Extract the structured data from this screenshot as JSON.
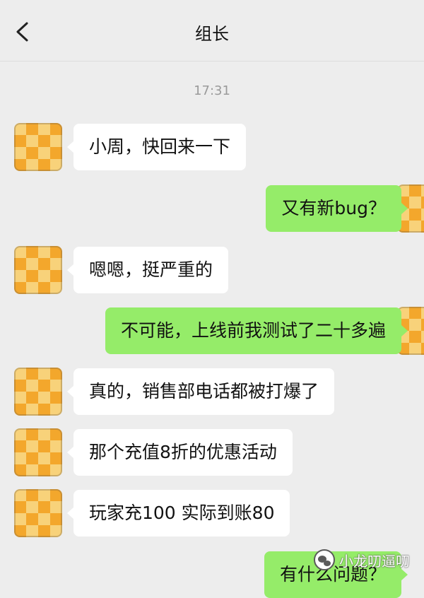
{
  "header": {
    "title": "组长"
  },
  "timestamp": "17:31",
  "messages": [
    {
      "text": "小周，快回来一下",
      "sender": "contact"
    },
    {
      "text": "又有新bug？",
      "sender": "me"
    },
    {
      "text": "嗯嗯，挺严重的",
      "sender": "contact"
    },
    {
      "text": "不可能，上线前我测试了二十多遍",
      "sender": "me"
    },
    {
      "text": "真的，销售部电话都被打爆了",
      "sender": "contact"
    },
    {
      "text": "那个充值8折的优惠活动",
      "sender": "contact"
    },
    {
      "text": "玩家充100 实际到账80",
      "sender": "contact"
    },
    {
      "text": "有什么问题？",
      "sender": "me"
    }
  ],
  "watermark": {
    "text": "小龙叨逼叨",
    "icon": "wechat-logo-icon"
  },
  "colors": {
    "incoming_bubble": "#ffffff",
    "outgoing_bubble": "#95ec69",
    "background": "#ededed"
  }
}
